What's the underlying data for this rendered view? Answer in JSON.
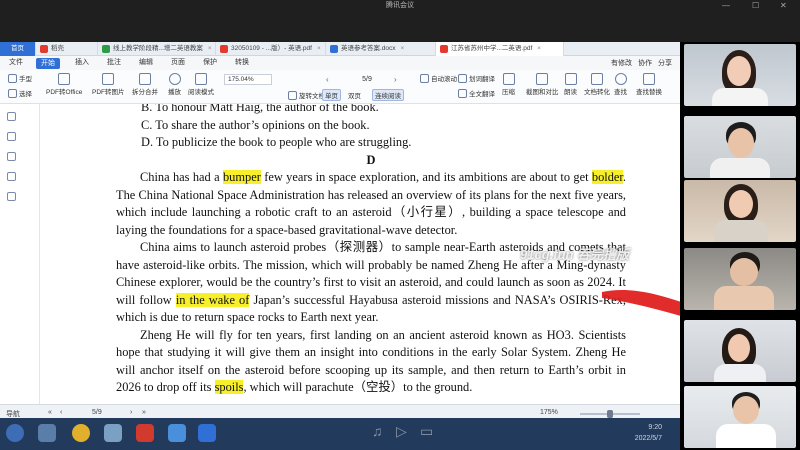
{
  "meeting": {
    "title": "腾讯会议",
    "controls": [
      "—",
      "☐",
      "✕"
    ]
  },
  "tabs": [
    {
      "label": "首页",
      "kind": "home"
    },
    {
      "label": "稻壳",
      "color": "#e23b2e"
    },
    {
      "label": "线上教学阶段精...增二英语教案",
      "color": "#2f9b44"
    },
    {
      "label": "32050109 - ...版）- 英语.pdf",
      "color": "#e23b2e"
    },
    {
      "label": "英语参考答案.docx",
      "color": "#2f6fd6"
    },
    {
      "label": "江苏省苏州中学...二英语.pdf",
      "color": "#e23b2e",
      "active": true
    }
  ],
  "menu": {
    "items": [
      "文件",
      "开始",
      "插入",
      "批注",
      "编辑",
      "页面",
      "保护",
      "转换"
    ],
    "right": [
      "有修改",
      "协作",
      "分享"
    ]
  },
  "ribbon": {
    "hand": "手型",
    "select": "选择",
    "pdf_to_office": "PDF转Office",
    "pdf_to_image": "PDF转图片",
    "split_merge": "拆分合并",
    "play": "播放",
    "read_mode": "阅读模式",
    "zoom": "175.04%",
    "page": "5/9",
    "rotate": "旋转文档",
    "single": "单页",
    "double": "双页",
    "continuous": "连续阅读",
    "auto_scroll": "自动滚动",
    "translate": "划词翻译",
    "full_translate": "全文翻译",
    "compress": "压缩",
    "screenshot_compare": "截图和对比",
    "read_aloud": "朗读",
    "doc_convert": "文档转化",
    "find": "查找",
    "find_replace": "查找替换"
  },
  "document": {
    "option_b": "B.  To honour Matt Haig, the author of the book.",
    "option_c": "C.  To share the author’s opinions on the book.",
    "option_d": "D.  To publicize the book to people who are struggling.",
    "section": "D",
    "p1_a": "China has had a ",
    "p1_hl1": "bumper",
    "p1_b": " few years in space exploration, and its ambitions are about to get ",
    "p1_hl2": "bolder",
    "p1_c": ". The China National Space Administration has released an overview of its plans for the next five years, which include launching a robotic craft to an asteroid（小行星）, building a space telescope and laying the foundations for a space-based gravitational-wave detector.",
    "p2_a": "China aims to launch asteroid probes（探测器）to sample near-Earth asteroids and comets that have asteroid-like orbits. The mission, which will probably be named Zheng He after a Ming-dynasty Chinese explorer, would be the country’s first to visit an asteroid, and could launch as soon as 2024. It will follow ",
    "p2_hl": "in the wake of",
    "p2_b": " Japan’s successful Hayabusa asteroid missions and NASA’s OSIRIS-Rex, which is due to return space rocks to Earth next year.",
    "p3_a": "Zheng He will fly for ten years, first landing on an ancient asteroid known as HO3. Scientists hope that studying it will give them an insight into conditions in the early Solar System. Zheng He will anchor itself on the asteroid before scooping up its sample, and then return to Earth’s orbit in 2026 to drop off its ",
    "p3_hl": "spoils",
    "p3_b": ", which will parachute（空投）to the ground."
  },
  "statusbar": {
    "nav": "导航",
    "page": "5/9",
    "zoom": "175%",
    "zoom_fraction": 0.5
  },
  "taskbar": {
    "time": "9:20",
    "date": "2022/5/7"
  },
  "watermark": "91cg.fun 吞完撸版",
  "colors": {
    "highlight": "#f6ef2a",
    "accent": "#2f6fd6",
    "arrow": "#e01a1a"
  }
}
